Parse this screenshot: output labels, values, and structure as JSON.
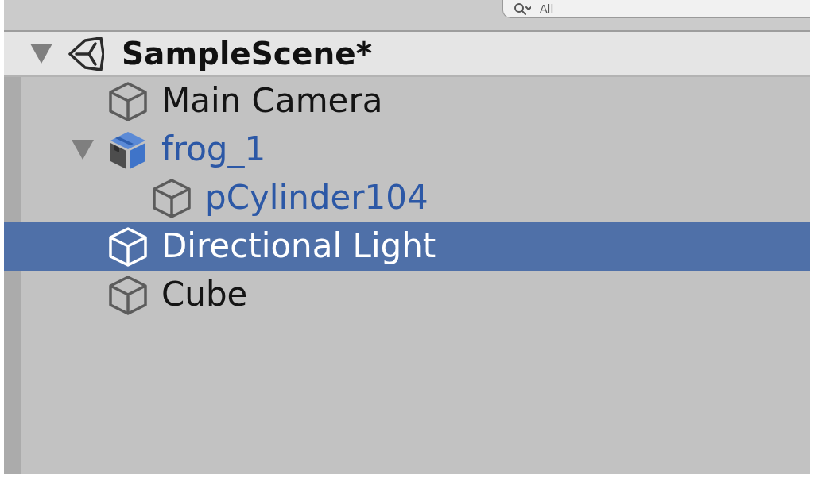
{
  "toolbar": {
    "search_field": {
      "placeholder": "All"
    }
  },
  "scene": {
    "name": "SampleScene*",
    "expanded": true
  },
  "hierarchy": [
    {
      "name": "Main Camera",
      "kind": "object",
      "selected": false
    },
    {
      "name": "frog_1",
      "kind": "prefab",
      "selected": false,
      "expanded": true,
      "children": [
        {
          "name": "pCylinder104",
          "kind": "prefab_child",
          "selected": false
        }
      ]
    },
    {
      "name": "Directional Light",
      "kind": "object",
      "selected": true
    },
    {
      "name": "Cube",
      "kind": "object",
      "selected": false
    }
  ]
}
